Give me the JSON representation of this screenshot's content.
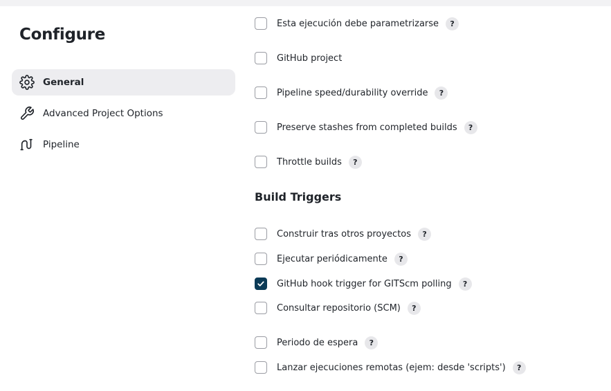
{
  "page": {
    "title": "Configure"
  },
  "sidebar": {
    "items": [
      {
        "label": "General",
        "icon": "gear-icon",
        "active": true
      },
      {
        "label": "Advanced Project Options",
        "icon": "wrench-icon",
        "active": false
      },
      {
        "label": "Pipeline",
        "icon": "pipeline-icon",
        "active": false
      }
    ]
  },
  "general": {
    "options": [
      {
        "label": "Esta ejecución debe parametrizarse",
        "checked": false,
        "help": true
      },
      {
        "label": "GitHub project",
        "checked": false,
        "help": false
      },
      {
        "label": "Pipeline speed/durability override",
        "checked": false,
        "help": true
      },
      {
        "label": "Preserve stashes from completed builds",
        "checked": false,
        "help": true
      },
      {
        "label": "Throttle builds",
        "checked": false,
        "help": true
      }
    ]
  },
  "build_triggers": {
    "title": "Build Triggers",
    "options": [
      {
        "label": "Construir tras otros proyectos",
        "checked": false,
        "help": true
      },
      {
        "label": "Ejecutar periódicamente",
        "checked": false,
        "help": true
      },
      {
        "label": "GitHub hook trigger for GITScm polling",
        "checked": true,
        "help": true
      },
      {
        "label": "Consultar repositorio (SCM)",
        "checked": false,
        "help": true
      },
      {
        "label": "Periodo de espera",
        "checked": false,
        "help": true
      },
      {
        "label": "Lanzar ejecuciones remotas (ejem: desde 'scripts')",
        "checked": false,
        "help": true
      }
    ]
  },
  "help_glyph": "?",
  "colors": {
    "checked_fill": "#0b3a56",
    "active_nav_bg": "#ededf0",
    "help_bg": "#e7e7ea"
  }
}
